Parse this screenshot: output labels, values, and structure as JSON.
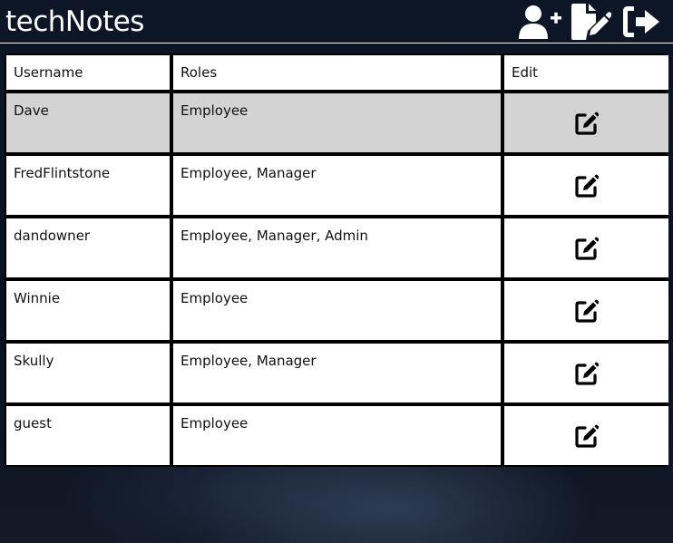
{
  "header": {
    "title": "techNotes",
    "icons": [
      "add-user-icon",
      "new-note-icon",
      "logout-icon"
    ]
  },
  "table": {
    "columns": [
      "Username",
      "Roles",
      "Edit"
    ],
    "rows": [
      {
        "username": "Dave",
        "roles": "Employee",
        "selected": true
      },
      {
        "username": "FredFlintstone",
        "roles": "Employee, Manager",
        "selected": false
      },
      {
        "username": "dandowner",
        "roles": "Employee, Manager, Admin",
        "selected": false
      },
      {
        "username": "Winnie",
        "roles": "Employee",
        "selected": false
      },
      {
        "username": "Skully",
        "roles": "Employee, Manager",
        "selected": false
      },
      {
        "username": "guest",
        "roles": "Employee",
        "selected": false
      }
    ]
  },
  "colors": {
    "background": "#0d1626",
    "header_text": "#ffffff",
    "cell_bg": "#ffffff",
    "selected_row_bg": "#d3d3d3",
    "grid_lines": "#000000"
  }
}
